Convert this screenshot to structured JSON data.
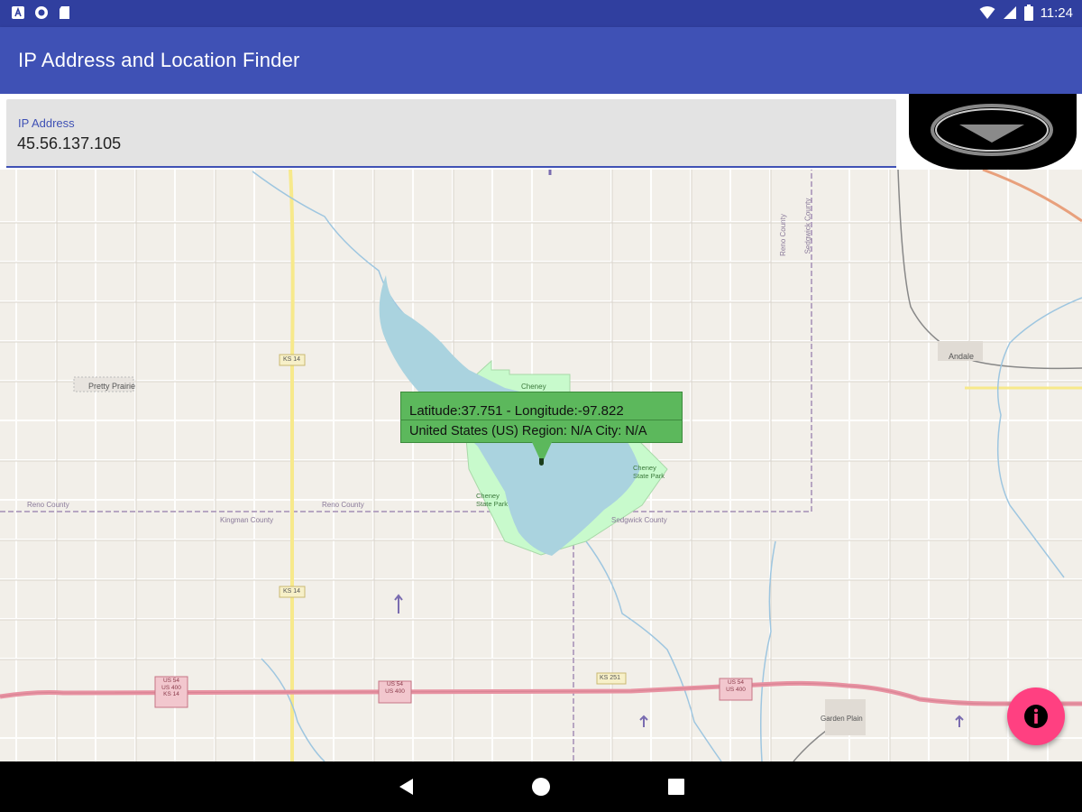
{
  "status_bar": {
    "time": "11:24",
    "left_icons": [
      "android-notification-icon",
      "circle-notification-icon",
      "sd-card-icon"
    ],
    "right_icons": [
      "wifi-icon",
      "signal-icon",
      "battery-icon"
    ]
  },
  "app_bar": {
    "title": "IP Address and Location Finder"
  },
  "ip_input": {
    "label": "IP Address",
    "value": "45.56.137.105"
  },
  "popup": {
    "line1": "Latitude:37.751 - Longitude:-97.822",
    "line2": "United States (US) Region: N/A City: N/A"
  },
  "map_labels": {
    "pretty_prairie": "Pretty Prairie",
    "cheney": "Cheney",
    "cheney_state_park_east": "Cheney State Park",
    "cheney_state_park_west": "Cheney State Park",
    "reno_county_1": "Reno County",
    "reno_county_2": "Reno County",
    "kingman_county": "Kingman County",
    "sedgwick_county_south": "Sedgwick County",
    "reno_county_north": "Reno County",
    "sedgwick_county_north": "Sedgwick County",
    "andale": "Andale",
    "garden_plain": "Garden Plain",
    "ks14_north": "KS 14",
    "ks14_south": "KS 14",
    "ks251": "KS 251",
    "us54_a_1": "US 54",
    "us54_a_2": "US 400",
    "us54_a_3": "KS 14",
    "us54_b_1": "US 54",
    "us54_b_2": "US 400",
    "us54_c_1": "US 54",
    "us54_c_2": "US 400"
  },
  "colors": {
    "status_bar": "#303f9f",
    "app_bar": "#3f51b5",
    "popup": "#5cb85c",
    "fab": "#ff4081",
    "water": "#aad3df",
    "park": "#c8facc",
    "highway": "#e892a2",
    "map_bg": "#f2efe9"
  },
  "fab_icon": "info-icon",
  "drop_button_icon": "dropdown-triangle-icon",
  "nav": {
    "back_icon": "back-triangle-icon",
    "home_icon": "home-circle-icon",
    "recents_icon": "recents-square-icon"
  }
}
